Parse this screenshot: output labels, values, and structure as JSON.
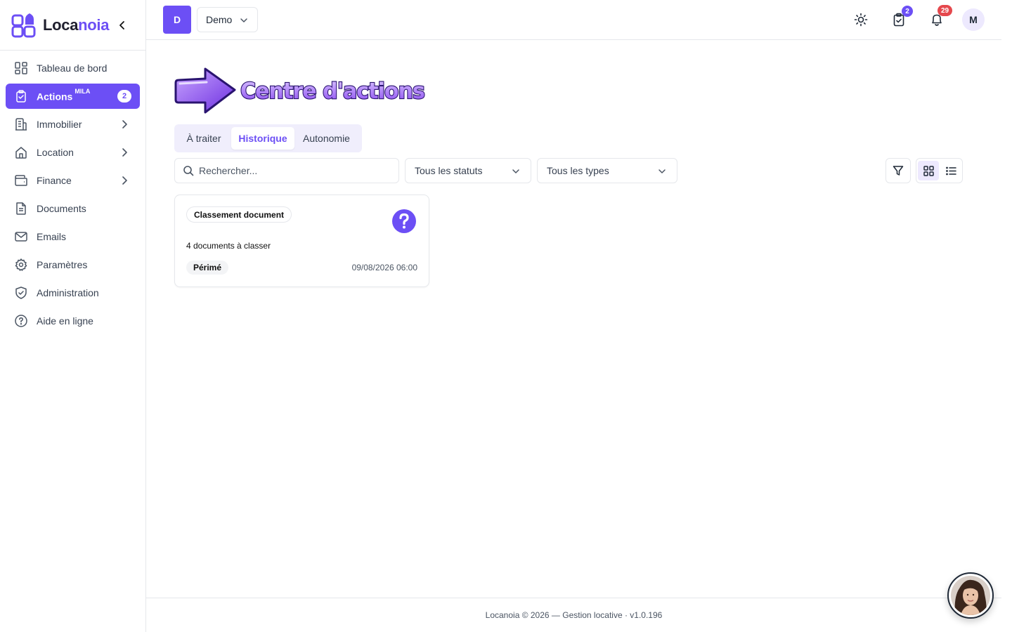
{
  "brand": {
    "name_main": "Loca",
    "name_accent": "noia"
  },
  "sidebar": {
    "items": [
      {
        "label": "Tableau de bord",
        "icon": "dashboard-icon"
      },
      {
        "label": "Actions",
        "superscript": "MILA",
        "badge": "2",
        "icon": "clipboard-check-icon",
        "active": true
      },
      {
        "label": "Immobilier",
        "icon": "building-icon",
        "has_submenu": true
      },
      {
        "label": "Location",
        "icon": "home-icon",
        "has_submenu": true
      },
      {
        "label": "Finance",
        "icon": "wallet-icon",
        "has_submenu": true
      },
      {
        "label": "Documents",
        "icon": "document-icon"
      },
      {
        "label": "Emails",
        "icon": "mail-icon"
      },
      {
        "label": "Paramètres",
        "icon": "gear-icon"
      },
      {
        "label": "Administration",
        "icon": "shield-icon"
      },
      {
        "label": "Aide en ligne",
        "icon": "help-circle-icon"
      }
    ]
  },
  "header": {
    "org_initial": "D",
    "org_name": "Demo",
    "tasks_badge": "2",
    "notifications_badge": "29",
    "user_initial": "M"
  },
  "main": {
    "title": "Centre d'actions",
    "tabs": [
      {
        "label": "À traiter",
        "active": false
      },
      {
        "label": "Historique",
        "active": true
      },
      {
        "label": "Autonomie",
        "active": false
      }
    ],
    "search_placeholder": "Rechercher...",
    "status_filter": "Tous les statuts",
    "type_filter": "Tous les types",
    "view_mode": "grid"
  },
  "cards": [
    {
      "type": "Classement document",
      "description": "4 documents à classer",
      "status": "Périmé",
      "date": "09/08/2026 06:00",
      "icon": "question-circle-icon"
    }
  ],
  "footer": {
    "text": "Locanoia © 2026 — Gestion locative · v1.0.196"
  },
  "colors": {
    "accent": "#6c4ff5",
    "badge_red": "#e5484d",
    "border": "#e5e7eb"
  }
}
